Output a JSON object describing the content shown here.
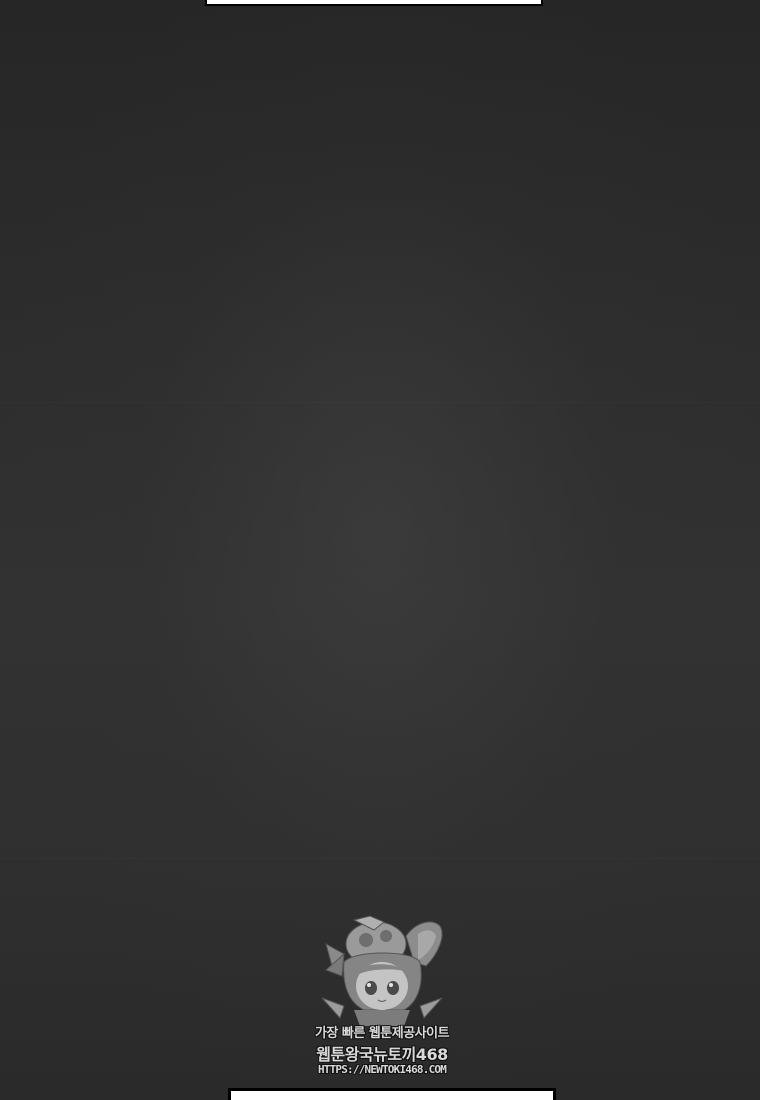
{
  "watermark": {
    "line1": "가장 빠른 웹툰제공사이트",
    "line2": "웹툰왕국뉴토끼468",
    "line3": "HTTPS://NEWTOKI468.COM",
    "icon": "bunny-girl-mascot-icon"
  },
  "colors": {
    "background": "#2e2e2e",
    "panel": "#ffffff",
    "watermark_text": "#d9d9d9"
  }
}
